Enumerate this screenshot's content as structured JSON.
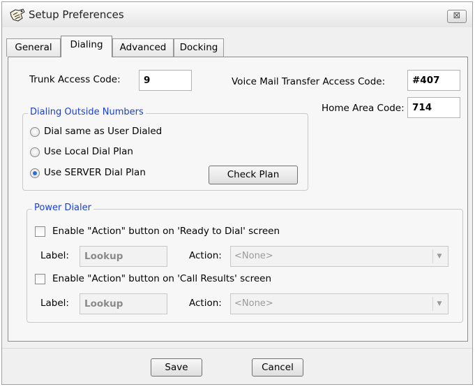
{
  "window": {
    "title": "Setup Preferences",
    "close_glyph": "⊠"
  },
  "tabs": [
    {
      "label": "General"
    },
    {
      "label": "Dialing"
    },
    {
      "label": "Advanced"
    },
    {
      "label": "Docking"
    }
  ],
  "fields": {
    "trunk_label": "Trunk Access Code:",
    "trunk_value": "9",
    "vm_label": "Voice Mail Transfer Access Code:",
    "vm_value": "#407",
    "area_label": "Home Area Code:",
    "area_value": "714"
  },
  "dialing_outside": {
    "legend": "Dialing Outside Numbers",
    "options": [
      {
        "label": "Dial same as User Dialed",
        "checked": false
      },
      {
        "label": "Use Local Dial Plan",
        "checked": false
      },
      {
        "label": "Use SERVER Dial Plan",
        "checked": true
      }
    ],
    "check_plan_label": "Check Plan"
  },
  "power_dialer": {
    "legend": "Power Dialer",
    "rows": [
      {
        "enable_label": "Enable \"Action\" button on 'Ready to Dial' screen",
        "label_text": "Label:",
        "label_value": "Lookup",
        "action_text": "Action:",
        "action_value": "<None>"
      },
      {
        "enable_label": "Enable \"Action\" button on 'Call Results' screen",
        "label_text": "Label:",
        "label_value": "Lookup",
        "action_text": "Action:",
        "action_value": "<None>"
      }
    ]
  },
  "footer": {
    "save_label": "Save",
    "cancel_label": "Cancel"
  },
  "colors": {
    "legend": "#1a3fd0",
    "radio_dot": "#2c6fd6"
  }
}
